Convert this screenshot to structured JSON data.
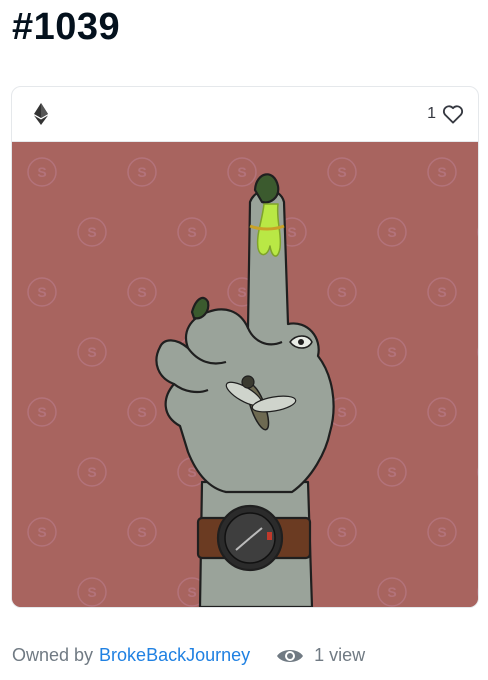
{
  "title": "#1039",
  "card": {
    "currency_icon": "ethereum-icon",
    "like_count": "1",
    "like_icon": "heart-outline-icon",
    "artwork": {
      "background_color": "#a8645f",
      "watermark_letter": "S",
      "nail_color": "#3b5a2e",
      "slime_color": "#b9e845",
      "skin_color": "#9aa39a",
      "strap_color": "#6b3b22"
    }
  },
  "footer": {
    "owned_by_label": "Owned by",
    "owner_name": "BrokeBackJourney",
    "views_icon": "eye-icon",
    "views_text": "1 view"
  },
  "colors": {
    "link": "#2081e2",
    "muted_text": "#707a83",
    "title_text": "#04111d"
  }
}
